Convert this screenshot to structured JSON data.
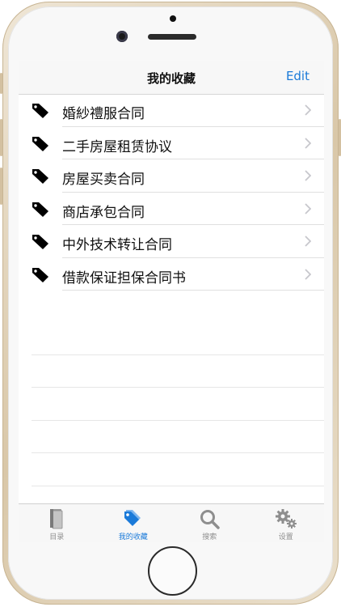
{
  "navbar": {
    "title": "我的收藏",
    "edit_label": "Edit"
  },
  "favorites": [
    {
      "label": "婚紗禮服合同"
    },
    {
      "label": "二手房屋租赁协议"
    },
    {
      "label": "房屋买卖合同"
    },
    {
      "label": "商店承包合同"
    },
    {
      "label": "中外技术转让合同"
    },
    {
      "label": "借款保证担保合同书"
    }
  ],
  "tabs": [
    {
      "label": "目录",
      "icon": "book-icon",
      "active": false
    },
    {
      "label": "我的收藏",
      "icon": "tag-icon",
      "active": true
    },
    {
      "label": "搜索",
      "icon": "search-icon",
      "active": false
    },
    {
      "label": "设置",
      "icon": "gears-icon",
      "active": false
    }
  ],
  "colors": {
    "accent": "#1a7ad9",
    "tag": "#000000",
    "inactive": "#8e8e8e"
  }
}
